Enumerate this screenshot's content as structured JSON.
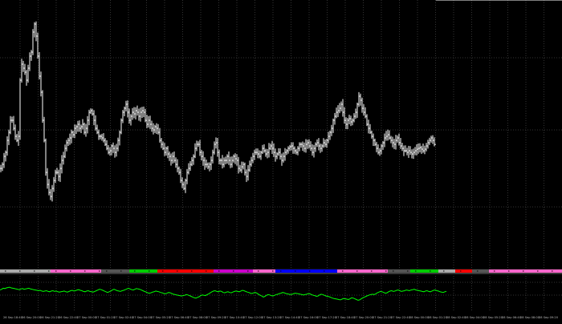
{
  "chart_data": [
    {
      "type": "line",
      "panel": "price",
      "style": "ohlc-bars",
      "grid": true,
      "x": [
        0,
        2,
        4,
        6,
        8,
        10,
        12,
        14,
        16,
        18,
        20,
        22,
        24,
        26,
        28,
        30,
        32,
        34,
        36,
        38,
        40,
        42,
        44,
        46,
        48,
        50,
        52,
        54,
        56,
        58,
        60,
        62,
        64,
        66,
        68,
        70,
        72,
        74,
        76,
        78,
        80,
        82,
        84,
        86,
        88,
        90,
        92,
        94,
        96,
        98,
        100,
        102,
        104,
        106,
        108,
        110,
        112,
        114,
        116,
        118,
        120,
        122,
        124,
        126,
        128,
        130,
        132,
        134,
        136,
        138,
        140,
        142,
        144,
        146,
        148,
        150,
        152,
        154,
        156,
        158,
        160,
        162,
        164,
        166,
        168,
        170,
        172,
        174,
        176,
        178,
        180,
        182,
        184,
        186,
        188,
        190,
        192,
        194,
        196,
        198,
        200,
        202,
        204,
        206,
        208,
        210,
        212,
        214,
        216,
        218,
        220,
        222,
        224,
        226,
        228,
        230,
        232,
        234,
        236,
        238,
        240,
        242,
        244,
        246,
        248,
        250,
        252,
        254,
        256,
        258,
        260,
        262,
        264,
        266,
        268,
        270,
        272,
        274,
        276,
        278,
        280,
        282,
        284,
        286,
        288,
        290,
        292,
        294,
        296,
        298,
        300,
        302,
        304,
        306,
        308,
        310,
        312,
        314,
        316,
        318,
        320,
        322,
        324,
        326,
        328,
        330,
        332,
        334,
        336,
        338,
        340,
        342,
        344,
        346,
        348,
        350,
        352,
        354,
        356,
        358,
        360,
        362,
        364,
        366,
        368,
        370,
        372,
        374,
        376,
        378,
        380,
        382,
        384,
        386,
        388,
        390,
        392,
        394,
        396,
        398,
        400,
        402,
        404,
        406,
        408,
        410,
        412,
        414,
        416,
        418,
        420,
        422,
        424,
        426,
        428,
        430,
        432,
        434,
        436,
        438,
        440,
        442,
        444,
        446,
        448,
        450,
        452,
        454,
        456,
        458,
        460,
        462,
        464,
        466,
        468,
        470,
        472,
        474,
        476,
        478,
        480,
        482,
        484,
        486,
        488,
        490,
        492,
        494,
        496,
        498,
        500,
        502,
        504,
        506,
        508,
        510,
        512,
        514,
        516,
        518,
        520,
        522,
        524,
        526,
        528,
        530,
        532,
        534,
        536,
        538,
        540,
        542,
        544,
        546,
        548,
        550,
        552,
        554,
        556,
        558,
        560,
        562,
        564,
        566,
        568,
        570,
        572,
        574,
        576,
        578,
        580,
        582,
        584,
        586,
        588,
        590,
        592,
        594,
        596,
        598,
        600,
        602,
        604,
        606,
        608,
        610,
        612,
        614,
        616,
        618,
        620,
        622,
        624,
        626,
        628,
        630,
        632,
        634,
        636,
        638,
        640,
        642,
        644,
        646,
        648,
        650,
        652,
        654,
        656,
        658,
        660,
        662,
        664,
        666,
        668,
        670,
        672,
        674,
        676,
        678,
        680,
        682,
        684,
        686,
        688,
        690,
        692,
        694,
        696,
        698
      ],
      "y": [
        210,
        205,
        195,
        190,
        175,
        165,
        150,
        150,
        160,
        170,
        175,
        170,
        100,
        80,
        85,
        90,
        100,
        85,
        70,
        65,
        40,
        30,
        45,
        70,
        95,
        115,
        150,
        175,
        215,
        230,
        240,
        245,
        235,
        225,
        215,
        215,
        220,
        210,
        200,
        195,
        185,
        178,
        175,
        172,
        165,
        168,
        160,
        158,
        155,
        160,
        158,
        155,
        165,
        160,
        150,
        140,
        138,
        142,
        150,
        160,
        165,
        170,
        170,
        172,
        175,
        180,
        185,
        190,
        188,
        182,
        185,
        190,
        185,
        175,
        165,
        150,
        140,
        135,
        130,
        140,
        150,
        145,
        140,
        142,
        138,
        140,
        145,
        140,
        138,
        140,
        150,
        155,
        150,
        155,
        160,
        162,
        158,
        160,
        165,
        175,
        180,
        185,
        190,
        185,
        192,
        195,
        200,
        195,
        200,
        205,
        210,
        215,
        225,
        230,
        235,
        225,
        215,
        210,
        205,
        200,
        195,
        185,
        180,
        180,
        190,
        195,
        200,
        205,
        205,
        208,
        205,
        200,
        190,
        180,
        178,
        190,
        200,
        200,
        205,
        200,
        200,
        195,
        200,
        205,
        200,
        195,
        198,
        200,
        210,
        212,
        208,
        205,
        215,
        220,
        212,
        205,
        200,
        195,
        190,
        190,
        192,
        195,
        190,
        185,
        188,
        192,
        190,
        185,
        182,
        185,
        190,
        195,
        192,
        190,
        195,
        200,
        195,
        190,
        188,
        185,
        183,
        182,
        185,
        188,
        190,
        185,
        180,
        180,
        182,
        185,
        180,
        178,
        182,
        185,
        190,
        185,
        180,
        178,
        182,
        185,
        182,
        178,
        180,
        175,
        170,
        165,
        160,
        150,
        145,
        140,
        138,
        135,
        130,
        140,
        150,
        155,
        150,
        148,
        152,
        150,
        145,
        140,
        130,
        120,
        125,
        135,
        140,
        145,
        155,
        160,
        165,
        170,
        175,
        180,
        185,
        190,
        188,
        182,
        178,
        172,
        170,
        168,
        172,
        175,
        178,
        180,
        175,
        172,
        178,
        182,
        185,
        188,
        188,
        190,
        188,
        190,
        192,
        190,
        188,
        186,
        185,
        184,
        186,
        188,
        186,
        182,
        178,
        175,
        172,
        175,
        180
      ],
      "xlabel": "",
      "ylabel": ""
    },
    {
      "type": "line",
      "panel": "indicator",
      "color": "#00ff00",
      "grid": true,
      "x": [
        0,
        2,
        4,
        6,
        8,
        10,
        12,
        14,
        16,
        18,
        20,
        22,
        24,
        26,
        28,
        30,
        32,
        34,
        36,
        38,
        40,
        42,
        44,
        46,
        48,
        50,
        52,
        54,
        56,
        58,
        60,
        62,
        64,
        66,
        68,
        70,
        72,
        74,
        76,
        78,
        80,
        82,
        84,
        86,
        88,
        90,
        92,
        94,
        96,
        98,
        100,
        102,
        104,
        106,
        108,
        110,
        112,
        114,
        116,
        118,
        120,
        122,
        124,
        126,
        128,
        130,
        132,
        134,
        136,
        138,
        140,
        142,
        144,
        146,
        148,
        150,
        152,
        154,
        156,
        158,
        160,
        162,
        164,
        166,
        168,
        170,
        172,
        174,
        176,
        178,
        180,
        182,
        184,
        186,
        188,
        190,
        192,
        194,
        196,
        198,
        200,
        202,
        204,
        206,
        208,
        210,
        212,
        214,
        216,
        218,
        220,
        222,
        224,
        226,
        228,
        230,
        232,
        234,
        236,
        238,
        240,
        242,
        244,
        246,
        248,
        250,
        252,
        254,
        256,
        258,
        260,
        262,
        264,
        266,
        268,
        270,
        272,
        274,
        276,
        278,
        280,
        282,
        284,
        286,
        288,
        290,
        292,
        294,
        296,
        298,
        300,
        302,
        304,
        306,
        308,
        310,
        312,
        314,
        316,
        318,
        320,
        322,
        324,
        326,
        328,
        330,
        332,
        334,
        336,
        338,
        340,
        342,
        344,
        346,
        348,
        350,
        352,
        354,
        356,
        358,
        360,
        362,
        364,
        366,
        368,
        370,
        372,
        374,
        376,
        378,
        380,
        382,
        384,
        386,
        388,
        390,
        392,
        394,
        396,
        398,
        400,
        402,
        404,
        406,
        408,
        410,
        412,
        414,
        416,
        418,
        420,
        422,
        424,
        426,
        428,
        430,
        432,
        434,
        436,
        438,
        440,
        442,
        444,
        446,
        448,
        450,
        452,
        454,
        456,
        458,
        460,
        462,
        464,
        466,
        468,
        470,
        472,
        474,
        476,
        478,
        480,
        482,
        484,
        486,
        488,
        490,
        492,
        494,
        496,
        498,
        500,
        502,
        504,
        506,
        508,
        510,
        512,
        514,
        516,
        518,
        520,
        522,
        524,
        526,
        528,
        530,
        532,
        534,
        536,
        538,
        540,
        542,
        544,
        546,
        548,
        550,
        552,
        554,
        556,
        558,
        560,
        562,
        564,
        566,
        568,
        570,
        572,
        574,
        576,
        578,
        580,
        582,
        584,
        586,
        588,
        590,
        592,
        594,
        596,
        598,
        600,
        602,
        604,
        606,
        608,
        610,
        612,
        614,
        616,
        618,
        620,
        622,
        624,
        626,
        628,
        630,
        632,
        634,
        636,
        638,
        640,
        642,
        644,
        646,
        648,
        650,
        652,
        654,
        656,
        658,
        660,
        662,
        664,
        666,
        668,
        670,
        672,
        674,
        676,
        678,
        680,
        682,
        684,
        686,
        688,
        690,
        692,
        694,
        696,
        698
      ],
      "y": [
        60,
        62,
        65,
        64,
        66,
        67,
        68,
        66,
        65,
        64,
        63,
        62,
        61,
        63,
        64,
        62,
        63,
        64,
        65,
        63,
        62,
        61,
        60,
        59,
        58,
        59,
        57,
        56,
        57,
        58,
        56,
        55,
        57,
        58,
        56,
        57,
        55,
        54,
        55,
        56,
        57,
        55,
        54,
        56,
        58,
        59,
        57,
        58,
        60,
        61,
        59,
        58,
        56,
        55,
        57,
        58,
        56,
        55,
        54,
        56,
        58,
        60,
        62,
        61,
        59,
        57,
        55,
        53,
        55,
        57,
        60,
        62,
        60,
        58,
        57,
        56,
        58,
        59,
        61,
        63,
        65,
        63,
        61,
        60,
        62,
        64,
        63,
        62,
        60,
        58,
        56,
        54,
        52,
        51,
        52,
        54,
        55,
        57,
        56,
        55,
        53,
        52,
        50,
        49,
        51,
        53,
        52,
        50,
        48,
        47,
        46,
        45,
        44,
        43,
        44,
        45,
        47,
        46,
        44,
        42,
        40,
        38,
        37,
        39,
        41,
        44,
        46,
        45,
        44,
        47,
        49,
        52,
        55,
        57,
        58,
        56,
        55,
        57,
        56,
        53,
        52,
        54,
        55,
        53,
        52,
        54,
        56,
        57,
        56,
        55,
        57,
        59,
        58,
        56,
        54,
        53,
        51,
        50,
        52,
        53,
        51,
        48,
        45,
        43,
        40,
        42,
        45,
        47,
        46,
        44,
        43,
        45,
        47,
        48,
        50,
        51,
        53,
        52,
        50,
        49,
        48,
        47,
        48,
        50,
        51,
        50,
        49,
        48,
        47,
        46,
        47,
        48,
        50,
        49,
        47,
        45,
        44,
        42,
        43,
        46,
        48,
        47,
        45,
        43,
        42,
        41,
        39,
        37,
        36,
        35,
        34,
        33,
        32,
        34,
        36,
        35,
        34,
        33,
        35,
        38,
        37,
        35,
        33,
        31,
        32,
        35,
        38,
        40,
        42,
        44,
        46,
        47,
        48,
        47,
        49,
        52,
        54,
        56,
        55,
        53,
        51,
        52,
        55,
        57,
        58,
        56,
        57,
        59,
        60,
        58,
        56,
        57,
        58,
        60,
        59,
        58,
        60,
        61,
        62,
        60,
        59,
        58,
        57,
        56,
        55,
        57,
        58,
        56,
        55,
        57,
        59,
        60,
        58,
        57,
        55,
        54,
        53,
        55,
        56
      ],
      "ylim": [
        0,
        100
      ],
      "xlabel": "",
      "ylabel": ""
    }
  ],
  "separator": {
    "segments": [
      {
        "color": "#aaaaaa",
        "span": 0.09
      },
      {
        "color": "#ff66cc",
        "span": 0.09
      },
      {
        "color": "#555555",
        "span": 0.05
      },
      {
        "color": "#00cc00",
        "span": 0.05
      },
      {
        "color": "#ff0000",
        "span": 0.1
      },
      {
        "color": "#cc00cc",
        "span": 0.07
      },
      {
        "color": "#ff66cc",
        "span": 0.04
      },
      {
        "color": "#0000ff",
        "span": 0.11
      },
      {
        "color": "#ff66cc",
        "span": 0.09
      },
      {
        "color": "#555555",
        "span": 0.04
      },
      {
        "color": "#00cc00",
        "span": 0.05
      },
      {
        "color": "#aaaaaa",
        "span": 0.03
      },
      {
        "color": "#ff0000",
        "span": 0.03
      },
      {
        "color": "#555555",
        "span": 0.03
      },
      {
        "color": "#ff66cc",
        "span": 0.13
      }
    ]
  },
  "colors": {
    "background": "#000000",
    "grid": "#333333",
    "price_bars": "#ffffff",
    "indicator": "#00ff00",
    "axis_text": "#bbbbbb"
  },
  "time_axis": {
    "labels": [
      "26 Sep 18:40",
      "26 Sep 20:00",
      "26 Sep 21:20",
      "26 Sep 22:40",
      "27 Sep 00:00",
      "27 Sep 01:20",
      "27 Sep 02:40",
      "27 Sep 04:00",
      "27 Sep 05:20",
      "27 Sep 06:40",
      "27 Sep 08:00",
      "27 Sep 09:20",
      "27 Sep 10:40",
      "27 Sep 12:00",
      "27 Sep 13:20",
      "27 Sep 14:40",
      "27 Sep 16:00",
      "27 Sep 17:20",
      "27 Sep 18:40",
      "27 Sep 20:00",
      "27 Sep 21:20",
      "27 Sep 22:40",
      "28 Sep 00:00",
      "28 Sep 01:20",
      "28 Sep 02:40",
      "28 Sep 04:00",
      "28 Sep 05:20",
      "28 Sep 06:40",
      "28 Sep 08:00",
      "28 Sep 09:20"
    ]
  }
}
